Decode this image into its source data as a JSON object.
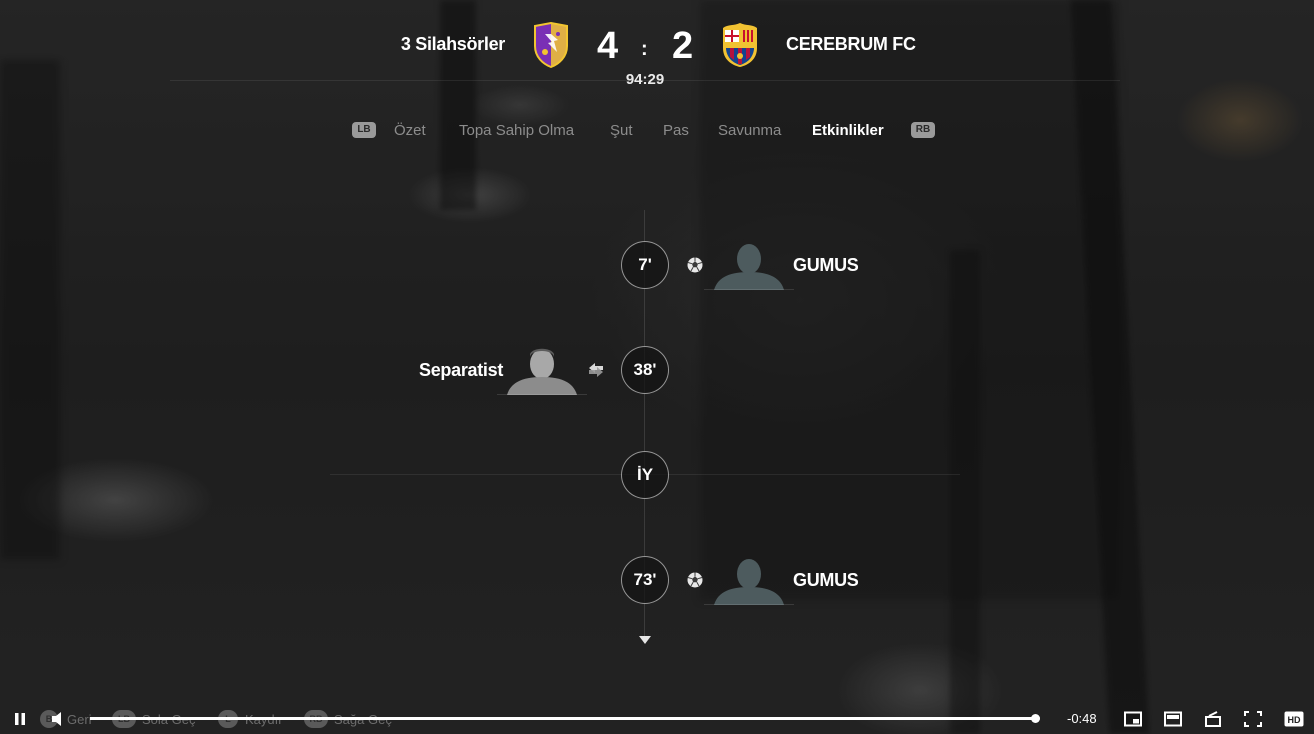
{
  "match": {
    "home_team": "3 Silahsörler",
    "away_team": "CEREBRUM FC",
    "home_score": "4",
    "away_score": "2",
    "score_separator": ":",
    "clock": "94:29",
    "colors": {
      "home_crest_primary": "#7a2fb5",
      "home_crest_secondary": "#f2c531",
      "away_crest_red": "#b4123e",
      "away_crest_blue": "#13438f",
      "away_crest_gold": "#f1c232"
    }
  },
  "tabs": {
    "left_bumper": "LB",
    "right_bumper": "RB",
    "items": [
      "Özet",
      "Topa Sahip Olma",
      "Şut",
      "Pas",
      "Savunma",
      "Etkinlikler"
    ],
    "active": "Etkinlikler"
  },
  "events": [
    {
      "minute": "7'",
      "side": "away",
      "type": "goal",
      "icon": "ball-icon",
      "player": "GUMUS"
    },
    {
      "minute": "38'",
      "side": "home",
      "type": "substitution",
      "icon": "substitution-icon",
      "player": "Separatist"
    },
    {
      "marker": "İY",
      "type": "half-time"
    },
    {
      "minute": "73'",
      "side": "away",
      "type": "goal",
      "icon": "ball-icon",
      "player": "GUMUS"
    }
  ],
  "hints": [
    {
      "badge": "B",
      "label": "Geri"
    },
    {
      "badge": "LB",
      "label": "Sola Geç"
    },
    {
      "badge": "L",
      "label": "Kaydır"
    },
    {
      "badge": "RB",
      "label": "Sağa Geç"
    }
  ],
  "player": {
    "time_remaining": "-0:48",
    "progress": 0.995,
    "hd_label": "HD"
  }
}
